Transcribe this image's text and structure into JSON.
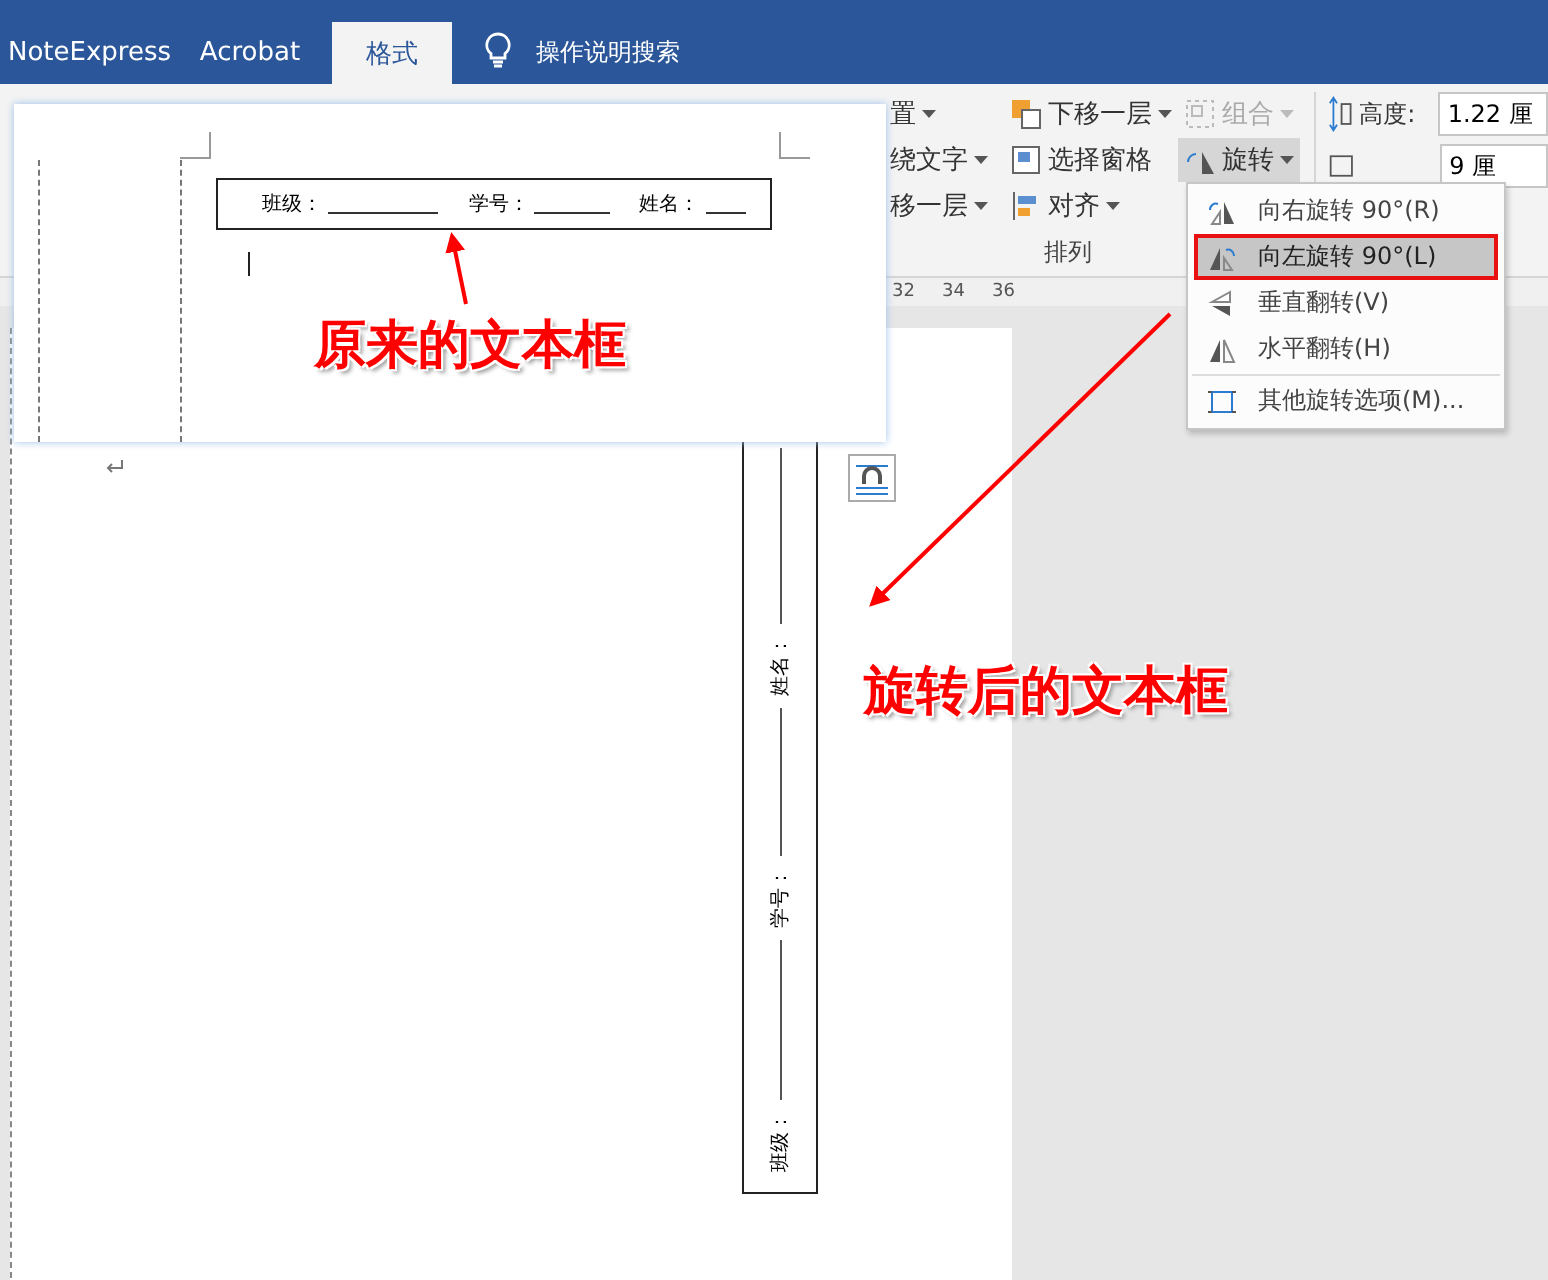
{
  "tabs": [
    {
      "label": "NoteExpress",
      "selected": false
    },
    {
      "label": "Acrobat",
      "selected": false
    },
    {
      "label": "格式",
      "selected": true
    }
  ],
  "search": {
    "label": "操作说明搜索"
  },
  "ribbon": {
    "columns": [
      [
        {
          "label": "置",
          "disabled": false,
          "pressed": false,
          "dropdown": true
        },
        {
          "label": "绕文字",
          "disabled": false,
          "pressed": false,
          "dropdown": true
        },
        {
          "label": "移一层",
          "disabled": false,
          "pressed": false,
          "dropdown": true
        }
      ],
      [
        {
          "label": "下移一层",
          "kind": "backward",
          "disabled": false,
          "pressed": false,
          "dropdown": true
        },
        {
          "label": "选择窗格",
          "kind": "pane",
          "disabled": false,
          "pressed": false,
          "dropdown": false
        },
        {
          "label": "对齐",
          "kind": "align",
          "disabled": false,
          "pressed": false,
          "dropdown": true
        }
      ],
      [
        {
          "label": "组合",
          "kind": "group",
          "disabled": true,
          "pressed": false,
          "dropdown": true
        },
        {
          "label": "旋转",
          "kind": "rotate",
          "disabled": false,
          "pressed": true,
          "dropdown": true
        }
      ]
    ],
    "group_label": "排列",
    "size": {
      "height_label": "高度:",
      "height_value": "1.22 厘",
      "width_value": "9 厘"
    }
  },
  "rotate_menu": [
    {
      "label": "向右旋转 90°(R)",
      "kind": "rotate-right",
      "selected": false
    },
    {
      "label": "向左旋转 90°(L)",
      "kind": "rotate-left",
      "selected": true
    },
    {
      "label": "垂直翻转(V)",
      "kind": "flip-vertical",
      "selected": false
    },
    {
      "label": "水平翻转(H)",
      "kind": "flip-horizontal",
      "selected": false
    },
    {
      "label": "其他旋转选项(M)...",
      "kind": "more",
      "selected": false
    }
  ],
  "ruler": [
    "32",
    "34",
    "36"
  ],
  "original_textbox": {
    "fields": [
      "班级：",
      "学号：",
      "姓名："
    ]
  },
  "rotated_textbox": {
    "fields": [
      "班级：",
      "学号：",
      "姓名："
    ]
  },
  "annotations": [
    "原来的文本框",
    "旋转后的文本框"
  ]
}
